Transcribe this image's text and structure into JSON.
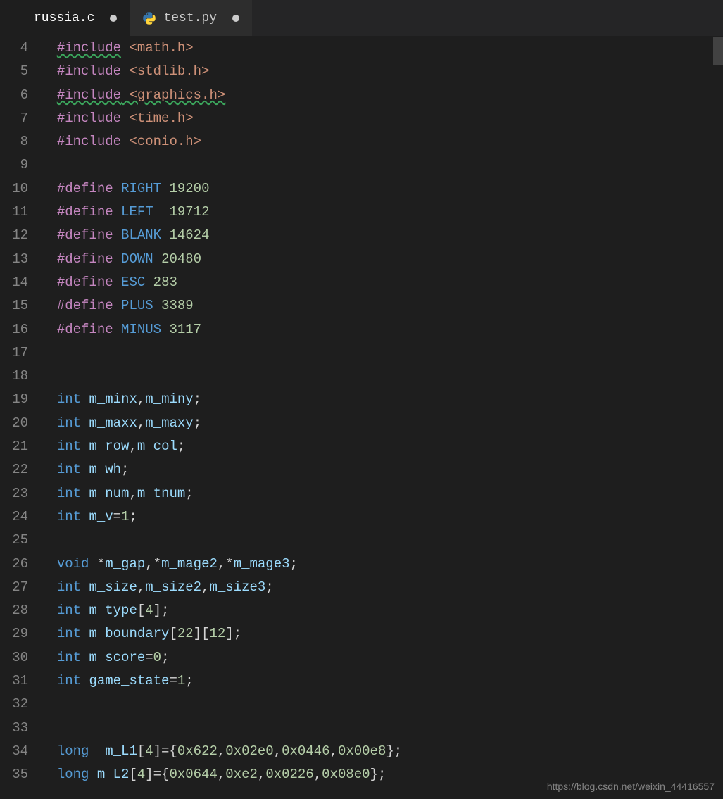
{
  "tabs": [
    {
      "label": "russia.c",
      "active": true,
      "dirty": true,
      "icon": "c-file-icon"
    },
    {
      "label": "test.py",
      "active": false,
      "dirty": true,
      "icon": "python-icon"
    }
  ],
  "watermark": "https://blog.csdn.net/weixin_44416557",
  "gutter_start": 4,
  "gutter_end": 35,
  "code_lines": [
    [
      {
        "k": "include-sq",
        "t": "#include"
      },
      {
        "k": "op",
        "t": " "
      },
      {
        "k": "string",
        "t": "<math.h>"
      }
    ],
    [
      {
        "k": "include",
        "t": "#include"
      },
      {
        "k": "op",
        "t": " "
      },
      {
        "k": "string",
        "t": "<stdlib.h>"
      }
    ],
    [
      {
        "k": "include-sq2",
        "t": "#include <graphics.h>"
      }
    ],
    [
      {
        "k": "include",
        "t": "#include"
      },
      {
        "k": "op",
        "t": " "
      },
      {
        "k": "string",
        "t": "<time.h>"
      }
    ],
    [
      {
        "k": "include",
        "t": "#include"
      },
      {
        "k": "op",
        "t": " "
      },
      {
        "k": "string",
        "t": "<conio.h>"
      }
    ],
    [],
    [
      {
        "k": "define",
        "t": "#define"
      },
      {
        "k": "op",
        "t": " "
      },
      {
        "k": "const",
        "t": "RIGHT"
      },
      {
        "k": "op",
        "t": " "
      },
      {
        "k": "number",
        "t": "19200"
      }
    ],
    [
      {
        "k": "define",
        "t": "#define"
      },
      {
        "k": "op",
        "t": " "
      },
      {
        "k": "const",
        "t": "LEFT"
      },
      {
        "k": "op",
        "t": "  "
      },
      {
        "k": "number",
        "t": "19712"
      }
    ],
    [
      {
        "k": "define",
        "t": "#define"
      },
      {
        "k": "op",
        "t": " "
      },
      {
        "k": "const",
        "t": "BLANK"
      },
      {
        "k": "op",
        "t": " "
      },
      {
        "k": "number",
        "t": "14624"
      }
    ],
    [
      {
        "k": "define",
        "t": "#define"
      },
      {
        "k": "op",
        "t": " "
      },
      {
        "k": "const",
        "t": "DOWN"
      },
      {
        "k": "op",
        "t": " "
      },
      {
        "k": "number",
        "t": "20480"
      }
    ],
    [
      {
        "k": "define",
        "t": "#define"
      },
      {
        "k": "op",
        "t": " "
      },
      {
        "k": "const",
        "t": "ESC"
      },
      {
        "k": "op",
        "t": " "
      },
      {
        "k": "number",
        "t": "283"
      }
    ],
    [
      {
        "k": "define",
        "t": "#define"
      },
      {
        "k": "op",
        "t": " "
      },
      {
        "k": "const",
        "t": "PLUS"
      },
      {
        "k": "op",
        "t": " "
      },
      {
        "k": "number",
        "t": "3389"
      }
    ],
    [
      {
        "k": "define",
        "t": "#define"
      },
      {
        "k": "op",
        "t": " "
      },
      {
        "k": "const",
        "t": "MINUS"
      },
      {
        "k": "op",
        "t": " "
      },
      {
        "k": "number",
        "t": "3117"
      }
    ],
    [],
    [],
    [
      {
        "k": "type",
        "t": "int"
      },
      {
        "k": "op",
        "t": " "
      },
      {
        "k": "ident",
        "t": "m_minx"
      },
      {
        "k": "op",
        "t": ","
      },
      {
        "k": "ident",
        "t": "m_miny"
      },
      {
        "k": "op",
        "t": ";"
      }
    ],
    [
      {
        "k": "type",
        "t": "int"
      },
      {
        "k": "op",
        "t": " "
      },
      {
        "k": "ident",
        "t": "m_maxx"
      },
      {
        "k": "op",
        "t": ","
      },
      {
        "k": "ident",
        "t": "m_maxy"
      },
      {
        "k": "op",
        "t": ";"
      }
    ],
    [
      {
        "k": "type",
        "t": "int"
      },
      {
        "k": "op",
        "t": " "
      },
      {
        "k": "ident",
        "t": "m_row"
      },
      {
        "k": "op",
        "t": ","
      },
      {
        "k": "ident",
        "t": "m_col"
      },
      {
        "k": "op",
        "t": ";"
      }
    ],
    [
      {
        "k": "type",
        "t": "int"
      },
      {
        "k": "op",
        "t": " "
      },
      {
        "k": "ident",
        "t": "m_wh"
      },
      {
        "k": "op",
        "t": ";"
      }
    ],
    [
      {
        "k": "type",
        "t": "int"
      },
      {
        "k": "op",
        "t": " "
      },
      {
        "k": "ident",
        "t": "m_num"
      },
      {
        "k": "op",
        "t": ","
      },
      {
        "k": "ident",
        "t": "m_tnum"
      },
      {
        "k": "op",
        "t": ";"
      }
    ],
    [
      {
        "k": "type",
        "t": "int"
      },
      {
        "k": "op",
        "t": " "
      },
      {
        "k": "ident",
        "t": "m_v"
      },
      {
        "k": "op",
        "t": "="
      },
      {
        "k": "number",
        "t": "1"
      },
      {
        "k": "op",
        "t": ";"
      }
    ],
    [],
    [
      {
        "k": "type",
        "t": "void"
      },
      {
        "k": "op",
        "t": " *"
      },
      {
        "k": "ident",
        "t": "m_gap"
      },
      {
        "k": "op",
        "t": ",*"
      },
      {
        "k": "ident",
        "t": "m_mage2"
      },
      {
        "k": "op",
        "t": ",*"
      },
      {
        "k": "ident",
        "t": "m_mage3"
      },
      {
        "k": "op",
        "t": ";"
      }
    ],
    [
      {
        "k": "type",
        "t": "int"
      },
      {
        "k": "op",
        "t": " "
      },
      {
        "k": "ident",
        "t": "m_size"
      },
      {
        "k": "op",
        "t": ","
      },
      {
        "k": "ident",
        "t": "m_size2"
      },
      {
        "k": "op",
        "t": ","
      },
      {
        "k": "ident",
        "t": "m_size3"
      },
      {
        "k": "op",
        "t": ";"
      }
    ],
    [
      {
        "k": "type",
        "t": "int"
      },
      {
        "k": "op",
        "t": " "
      },
      {
        "k": "ident",
        "t": "m_type"
      },
      {
        "k": "op",
        "t": "["
      },
      {
        "k": "number",
        "t": "4"
      },
      {
        "k": "op",
        "t": "];"
      }
    ],
    [
      {
        "k": "type",
        "t": "int"
      },
      {
        "k": "op",
        "t": " "
      },
      {
        "k": "ident",
        "t": "m_boundary"
      },
      {
        "k": "op",
        "t": "["
      },
      {
        "k": "number",
        "t": "22"
      },
      {
        "k": "op",
        "t": "]["
      },
      {
        "k": "number",
        "t": "12"
      },
      {
        "k": "op",
        "t": "];"
      }
    ],
    [
      {
        "k": "type",
        "t": "int"
      },
      {
        "k": "op",
        "t": " "
      },
      {
        "k": "ident",
        "t": "m_score"
      },
      {
        "k": "op",
        "t": "="
      },
      {
        "k": "number",
        "t": "0"
      },
      {
        "k": "op",
        "t": ";"
      }
    ],
    [
      {
        "k": "type",
        "t": "int"
      },
      {
        "k": "op",
        "t": " "
      },
      {
        "k": "ident",
        "t": "game_state"
      },
      {
        "k": "op",
        "t": "="
      },
      {
        "k": "number",
        "t": "1"
      },
      {
        "k": "op",
        "t": ";"
      }
    ],
    [],
    [],
    [
      {
        "k": "type",
        "t": "long"
      },
      {
        "k": "op",
        "t": "  "
      },
      {
        "k": "ident",
        "t": "m_L1"
      },
      {
        "k": "op",
        "t": "["
      },
      {
        "k": "number",
        "t": "4"
      },
      {
        "k": "op",
        "t": "]={"
      },
      {
        "k": "number",
        "t": "0x622"
      },
      {
        "k": "op",
        "t": ","
      },
      {
        "k": "number",
        "t": "0x02e0"
      },
      {
        "k": "op",
        "t": ","
      },
      {
        "k": "number",
        "t": "0x0446"
      },
      {
        "k": "op",
        "t": ","
      },
      {
        "k": "number",
        "t": "0x00e8"
      },
      {
        "k": "op",
        "t": "};"
      }
    ],
    [
      {
        "k": "type",
        "t": "long"
      },
      {
        "k": "op",
        "t": " "
      },
      {
        "k": "ident",
        "t": "m_L2"
      },
      {
        "k": "op",
        "t": "["
      },
      {
        "k": "number",
        "t": "4"
      },
      {
        "k": "op",
        "t": "]={"
      },
      {
        "k": "number",
        "t": "0x0644"
      },
      {
        "k": "op",
        "t": ","
      },
      {
        "k": "number",
        "t": "0xe2"
      },
      {
        "k": "op",
        "t": ","
      },
      {
        "k": "number",
        "t": "0x0226"
      },
      {
        "k": "op",
        "t": ","
      },
      {
        "k": "number",
        "t": "0x08e0"
      },
      {
        "k": "op",
        "t": "};"
      }
    ]
  ],
  "colors": {
    "bg": "#1e1e1e",
    "tab_bg": "#2d2d2d",
    "keyword": "#c586c0",
    "type": "#569cd6",
    "string": "#ce9178",
    "number": "#b5cea8",
    "ident": "#9cdcfe"
  }
}
